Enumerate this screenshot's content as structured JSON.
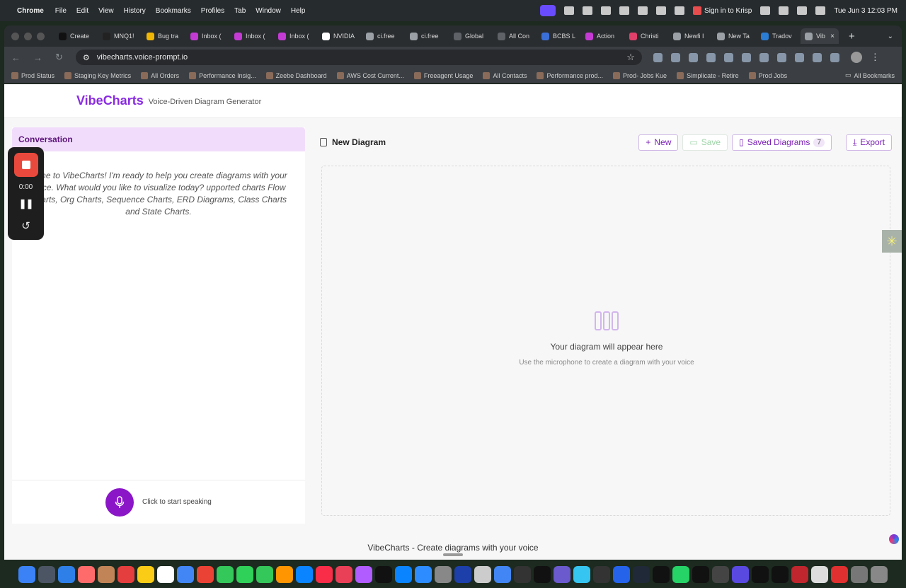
{
  "menubar": {
    "app": "Chrome",
    "items": [
      "File",
      "Edit",
      "View",
      "History",
      "Bookmarks",
      "Profiles",
      "Tab",
      "Window",
      "Help"
    ],
    "krisp": "Sign in to Krisp",
    "datetime": "Tue Jun 3  12:03 PM"
  },
  "tabs": [
    {
      "label": "Create",
      "color": "#111111"
    },
    {
      "label": "MNQ1!",
      "color": "#222222"
    },
    {
      "label": "Bug tra",
      "color": "#f2b705"
    },
    {
      "label": "Inbox (",
      "color": "#c43bd4"
    },
    {
      "label": "Inbox (",
      "color": "#c43bd4"
    },
    {
      "label": "Inbox (",
      "color": "#c43bd4"
    },
    {
      "label": "NVIDIA",
      "color": "#ffffff"
    },
    {
      "label": "ci.free",
      "color": "#9aa0a6"
    },
    {
      "label": "ci.free",
      "color": "#9aa0a6"
    },
    {
      "label": "Global",
      "color": "#5f6368"
    },
    {
      "label": "All Con",
      "color": "#5f6368"
    },
    {
      "label": "BCBS L",
      "color": "#3b6fd8"
    },
    {
      "label": "Action",
      "color": "#c43bd4"
    },
    {
      "label": "Christi",
      "color": "#e0406a"
    },
    {
      "label": "Newfi I",
      "color": "#9aa0a6"
    },
    {
      "label": "New Ta",
      "color": "#9aa0a6"
    },
    {
      "label": "Tradov",
      "color": "#2b7cd3"
    }
  ],
  "active_tab": "Vib",
  "address": "vibecharts.voice-prompt.io",
  "bookmarks": [
    "Prod Status",
    "Staging Key Metrics",
    "All Orders",
    "Performance Insig...",
    "Zeebe Dashboard",
    "AWS Cost Current...",
    "Freeagent Usage",
    "All Contacts",
    "Performance prod...",
    "Prod- Jobs Kue",
    "Simplicate - Retire",
    "Prod Jobs"
  ],
  "all_bookmarks": "All Bookmarks",
  "app": {
    "brand": "VibeCharts",
    "tagline": "Voice-Driven Diagram Generator"
  },
  "conversation": {
    "header": "Conversation",
    "welcome": "come to VibeCharts! I'm ready to help you create diagrams with your voice. What would you like to visualize today? upported charts Flow Charts, Org Charts, Sequence Charts, ERD Diagrams, Class Charts and State Charts.",
    "mic_hint": "Click to start speaking"
  },
  "diagram": {
    "title": "New Diagram",
    "new_label": "New",
    "save_label": "Save",
    "saved_label": "Saved Diagrams",
    "saved_count": "7",
    "export_label": "Export",
    "empty_title": "Your diagram will appear here",
    "empty_subtitle": "Use the microphone to create a diagram with your voice"
  },
  "recorder": {
    "time": "0:00"
  },
  "footer": "VibeCharts - Create diagrams with your voice",
  "colors": {
    "brand": "#8a2be2",
    "mic": "#8a16c8",
    "conversation_header_bg": "#f1ddfb",
    "record_stop": "#e9493c"
  },
  "dock_colors": [
    "#3b82f6",
    "#4b5563",
    "#2f7fe8",
    "#ff6b6b",
    "#c08457",
    "#e53e3e",
    "#facc15",
    "#ffffff",
    "#4285f4",
    "#ea4335",
    "#34c759",
    "#30d158",
    "#34c759",
    "#ff9500",
    "#0a84ff",
    "#fa2d48",
    "#e94057",
    "#b05cff",
    "#111111",
    "#0a84ff",
    "#2d8cff",
    "#888888",
    "#1c3faa",
    "#cccccc",
    "#4285f4",
    "#333333",
    "#111111",
    "#6a5acd",
    "#36c5f0",
    "#333333",
    "#2563eb",
    "#1f2937",
    "#111111",
    "#25d366",
    "#111111",
    "#444444",
    "#5a49e0",
    "#111111",
    "#111111",
    "#c0262d",
    "#dddddd",
    "#e03030",
    "#777777",
    "#888888"
  ]
}
